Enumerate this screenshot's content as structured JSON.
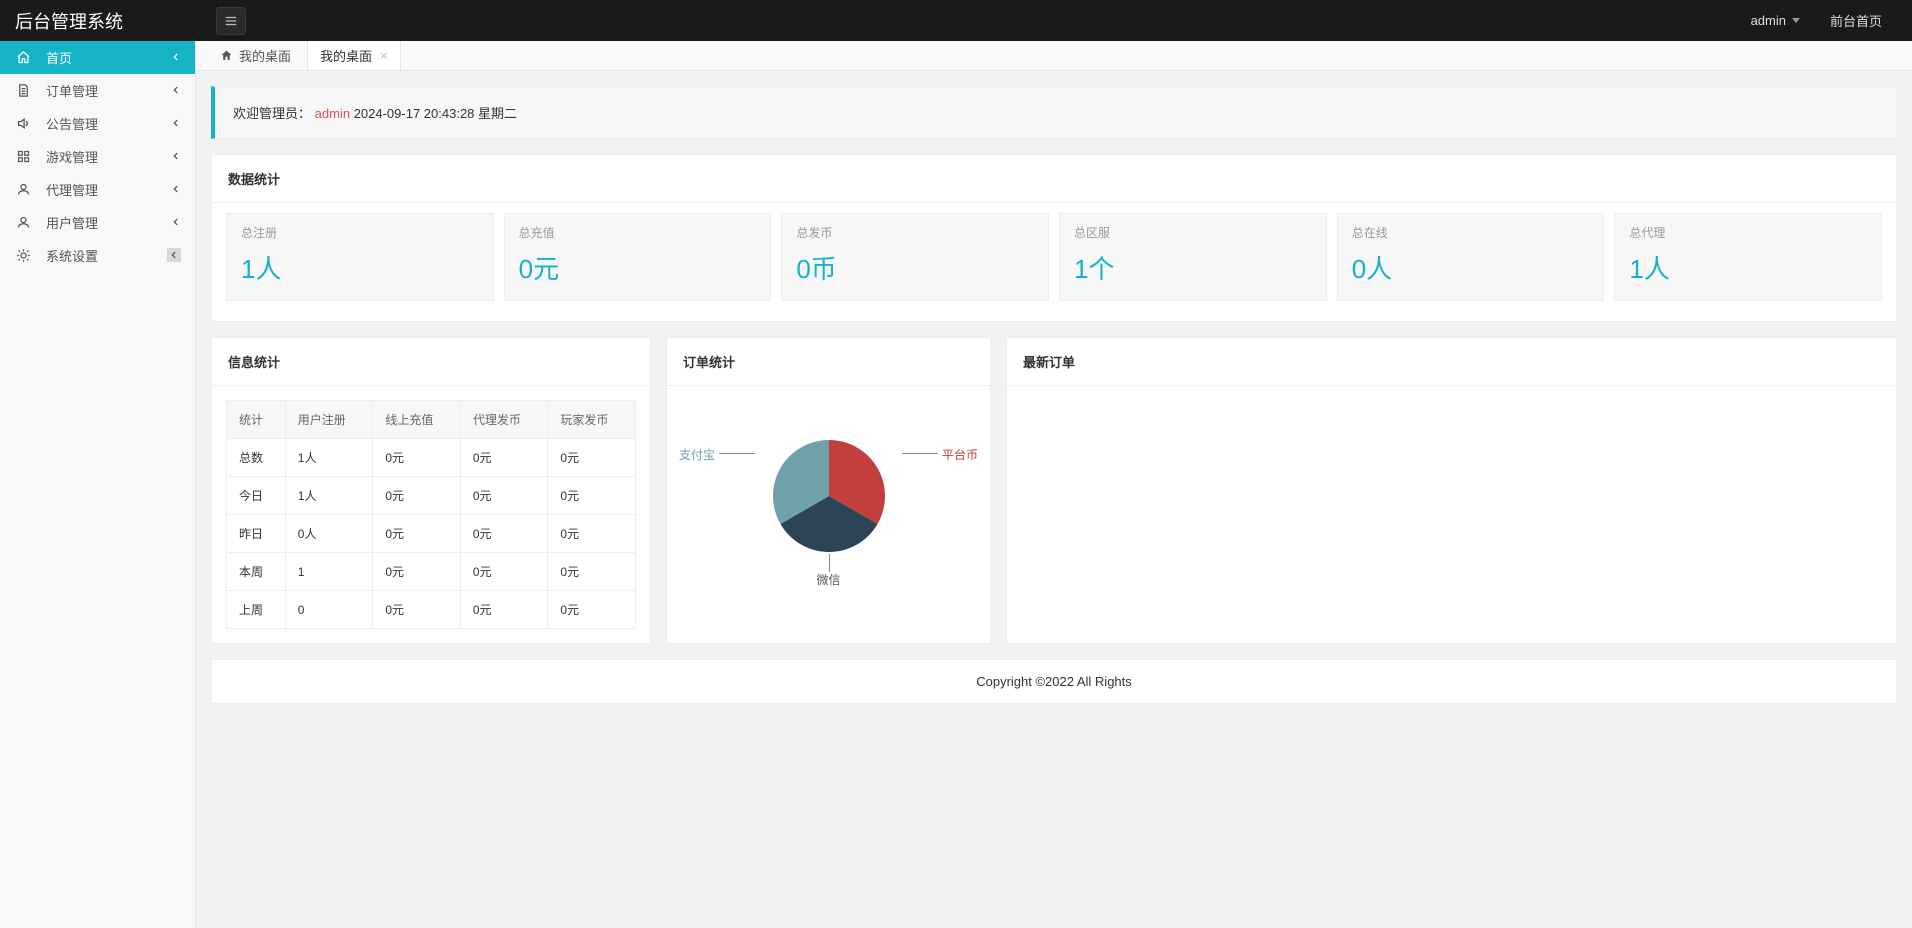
{
  "header": {
    "logo": "后台管理系统",
    "user": "admin",
    "front_link": "前台首页"
  },
  "sidebar": {
    "items": [
      {
        "label": "首页",
        "icon": "home",
        "active": true
      },
      {
        "label": "订单管理",
        "icon": "doc"
      },
      {
        "label": "公告管理",
        "icon": "speaker"
      },
      {
        "label": "游戏管理",
        "icon": "grid"
      },
      {
        "label": "代理管理",
        "icon": "user"
      },
      {
        "label": "用户管理",
        "icon": "user"
      },
      {
        "label": "系统设置",
        "icon": "gear",
        "settings": true
      }
    ]
  },
  "tabs": {
    "home_label": "我的桌面",
    "open_tab": "我的桌面"
  },
  "welcome": {
    "prefix": "欢迎管理员：",
    "admin": "admin",
    "datetime": "2024-09-17  20:43:28  星期二"
  },
  "stats": {
    "title": "数据统计",
    "cards": [
      {
        "label": "总注册",
        "value": "1人"
      },
      {
        "label": "总充值",
        "value": "0元"
      },
      {
        "label": "总发币",
        "value": "0币"
      },
      {
        "label": "总区服",
        "value": "1个"
      },
      {
        "label": "总在线",
        "value": "0人"
      },
      {
        "label": "总代理",
        "value": "1人"
      }
    ]
  },
  "info_panel": {
    "title": "信息统计",
    "headers": [
      "统计",
      "用户注册",
      "线上充值",
      "代理发币",
      "玩家发币"
    ],
    "rows": [
      [
        "总数",
        "1人",
        "0元",
        "0元",
        "0元"
      ],
      [
        "今日",
        "1人",
        "0元",
        "0元",
        "0元"
      ],
      [
        "昨日",
        "0人",
        "0元",
        "0元",
        "0元"
      ],
      [
        "本周",
        "1",
        "0元",
        "0元",
        "0元"
      ],
      [
        "上周",
        "0",
        "0元",
        "0元",
        "0元"
      ]
    ]
  },
  "order_panel": {
    "title": "订单统计"
  },
  "latest_panel": {
    "title": "最新订单"
  },
  "footer": {
    "text": "Copyright ©2022 All Rights"
  },
  "chart_data": {
    "type": "pie",
    "title": "订单统计",
    "series": [
      {
        "name": "支付宝",
        "value": 33.3,
        "color": "#6ea2a8"
      },
      {
        "name": "平台币",
        "value": 33.3,
        "color": "#c1403d"
      },
      {
        "name": "微信",
        "value": 33.3,
        "color": "#2b4556"
      }
    ]
  }
}
